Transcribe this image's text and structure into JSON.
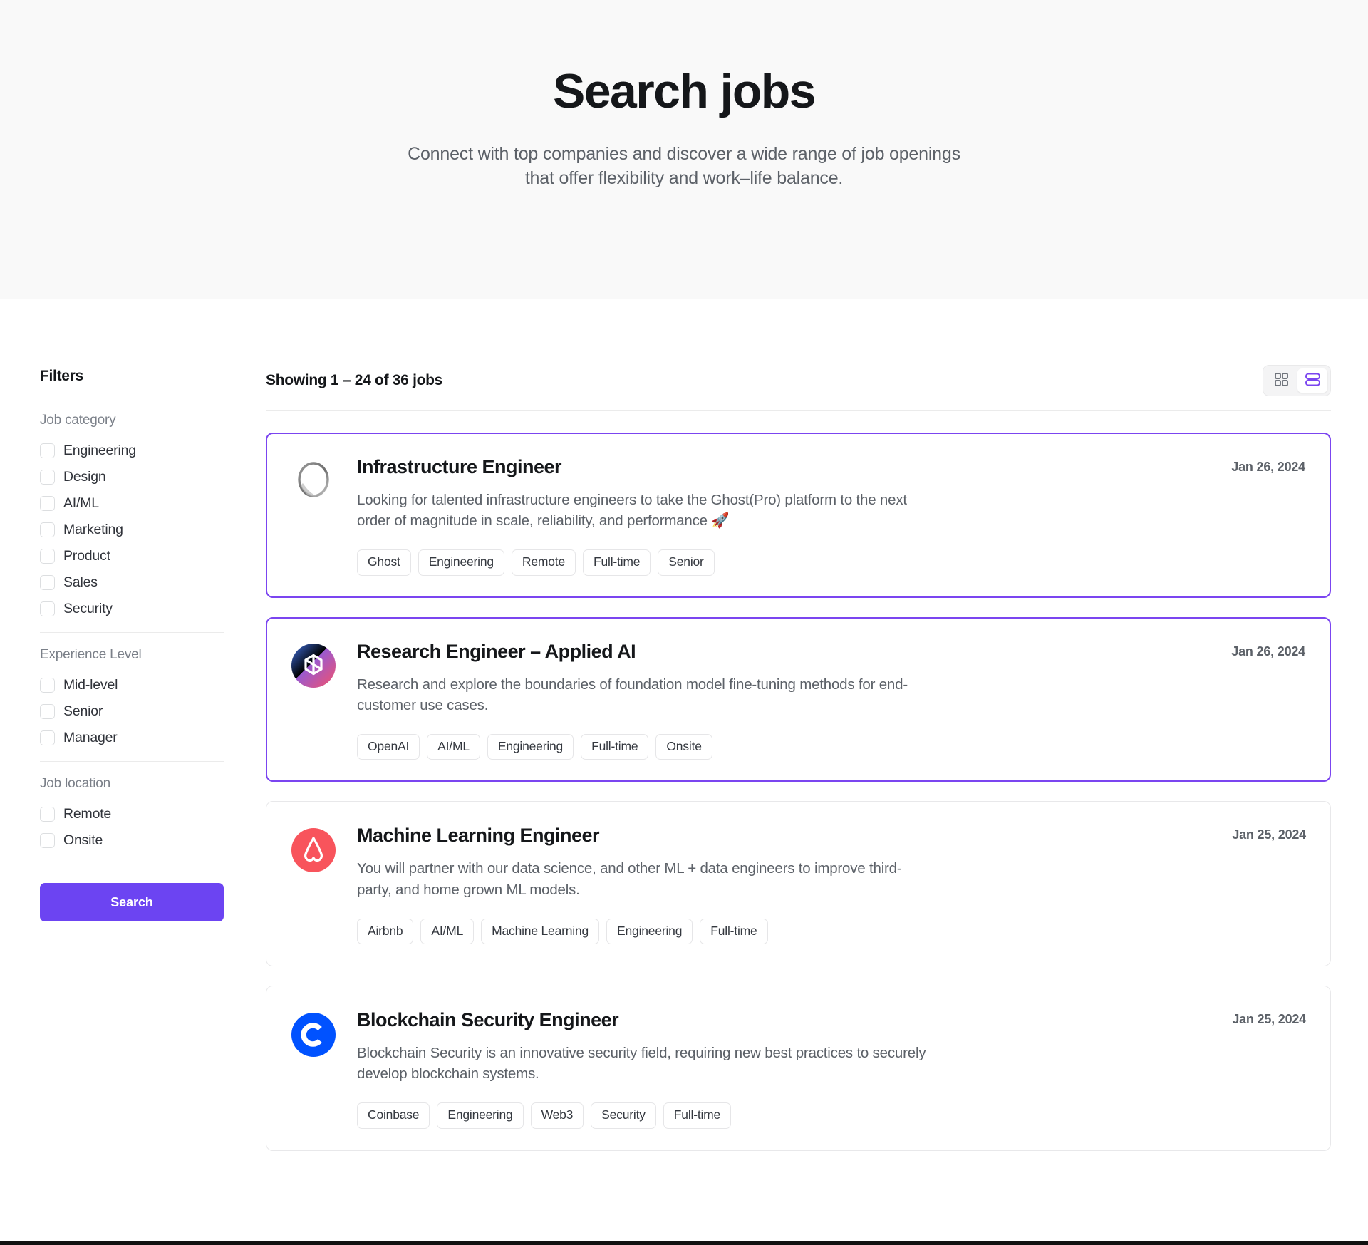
{
  "hero": {
    "title": "Search jobs",
    "subtitle_line1": "Connect with top companies and discover a wide range of job openings",
    "subtitle_line2": "that offer flexibility and work–life balance."
  },
  "sidebar": {
    "title": "Filters",
    "search_button": "Search",
    "groups": [
      {
        "label": "Job category",
        "options": [
          "Engineering",
          "Design",
          "AI/ML",
          "Marketing",
          "Product",
          "Sales",
          "Security"
        ]
      },
      {
        "label": "Experience Level",
        "options": [
          "Mid-level",
          "Senior",
          "Manager"
        ]
      },
      {
        "label": "Job location",
        "options": [
          "Remote",
          "Onsite"
        ]
      }
    ]
  },
  "results": {
    "count_text": "Showing 1 – 24 of 36 jobs",
    "view_modes": [
      {
        "name": "grid-view",
        "icon": "grid-icon",
        "active": false
      },
      {
        "name": "list-view",
        "icon": "list-icon",
        "active": true
      }
    ],
    "jobs": [
      {
        "title": "Infrastructure Engineer",
        "date": "Jan 26, 2024",
        "description": "Looking for talented infrastructure engineers to take the Ghost(Pro) platform to the next order of magnitude in scale, reliability, and performance 🚀",
        "company": "Ghost",
        "logo": "ghost-logo",
        "highlighted": true,
        "tags": [
          "Ghost",
          "Engineering",
          "Remote",
          "Full-time",
          "Senior"
        ]
      },
      {
        "title": "Research Engineer – Applied AI",
        "date": "Jan 26, 2024",
        "description": "Research and explore the boundaries of foundation model fine-tuning methods for end-customer use cases.",
        "company": "OpenAI",
        "logo": "openai-logo",
        "highlighted": true,
        "tags": [
          "OpenAI",
          "AI/ML",
          "Engineering",
          "Full-time",
          "Onsite"
        ]
      },
      {
        "title": "Machine Learning Engineer",
        "date": "Jan 25, 2024",
        "description": "You will partner with our data science, and other ML + data engineers to improve third-party, and home grown ML models.",
        "company": "Airbnb",
        "logo": "airbnb-logo",
        "highlighted": false,
        "tags": [
          "Airbnb",
          "AI/ML",
          "Machine Learning",
          "Engineering",
          "Full-time"
        ]
      },
      {
        "title": "Blockchain Security Engineer",
        "date": "Jan 25, 2024",
        "description": "Blockchain Security is an innovative security field, requiring new best practices to securely develop blockchain systems.",
        "company": "Coinbase",
        "logo": "coinbase-logo",
        "highlighted": false,
        "tags": [
          "Coinbase",
          "Engineering",
          "Web3",
          "Security",
          "Full-time"
        ]
      }
    ]
  },
  "colors": {
    "accent_purple": "#6c44f2",
    "highlight_border": "#7b45f0",
    "hero_background": "#f9f9f9",
    "airbnb_red": "#f8545c",
    "coinbase_blue": "#0052ff"
  }
}
